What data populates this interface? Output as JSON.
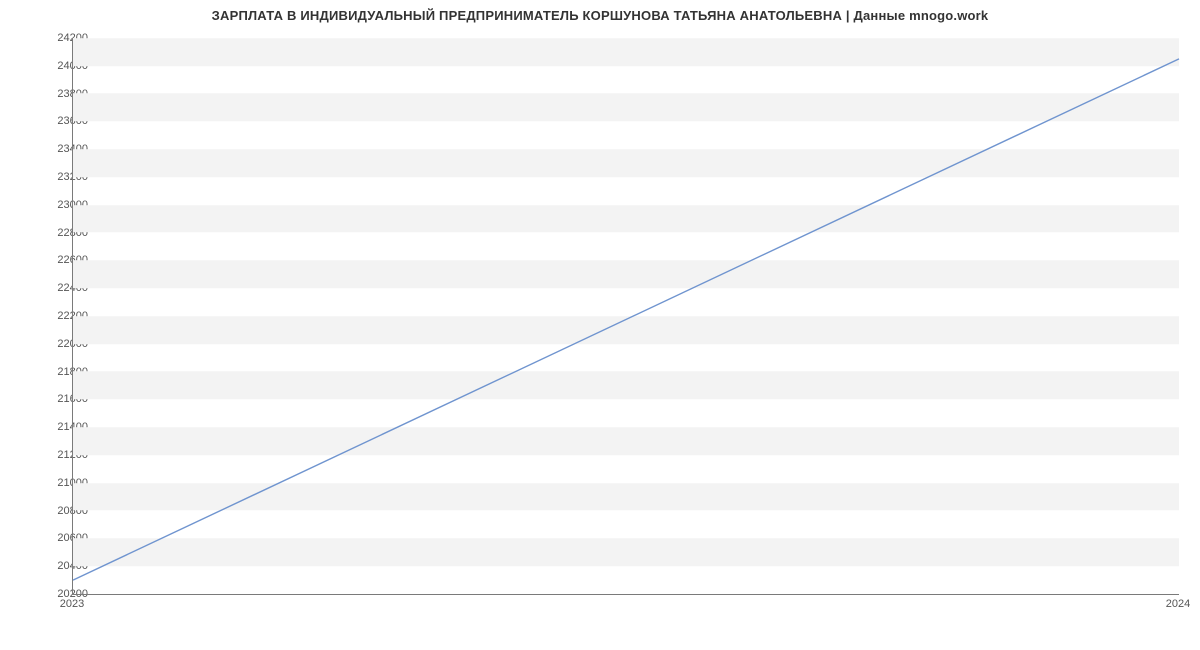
{
  "chart_data": {
    "type": "line",
    "title": "ЗАРПЛАТА В ИНДИВИДУАЛЬНЫЙ ПРЕДПРИНИМАТЕЛЬ КОРШУНОВА ТАТЬЯНА АНАТОЛЬЕВНА | Данные mnogo.work",
    "xlabel": "",
    "ylabel": "",
    "x": [
      2023,
      2024
    ],
    "values": [
      20300,
      24050
    ],
    "xlim": [
      2023,
      2024
    ],
    "ylim": [
      20200,
      24200
    ],
    "y_ticks": [
      20200,
      20400,
      20600,
      20800,
      21000,
      21200,
      21400,
      21600,
      21800,
      22000,
      22200,
      22400,
      22600,
      22800,
      23000,
      23200,
      23400,
      23600,
      23800,
      24000,
      24200
    ],
    "x_ticks": [
      2023,
      2024
    ],
    "grid": true,
    "line_color": "#6f94cf"
  }
}
